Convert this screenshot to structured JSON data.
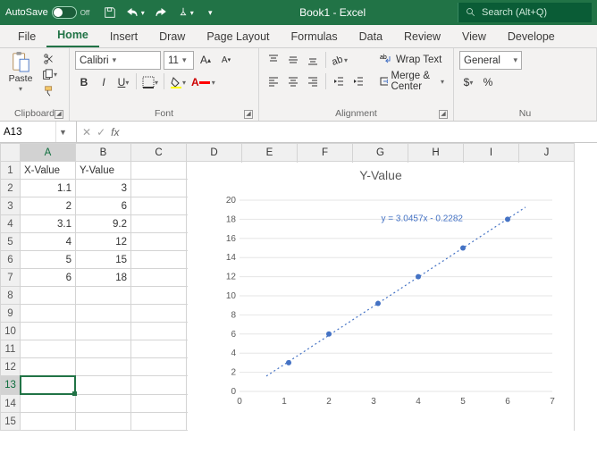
{
  "titlebar": {
    "autosave_label": "AutoSave",
    "autosave_state": "Off",
    "doc_title": "Book1 - Excel",
    "search_placeholder": "Search (Alt+Q)"
  },
  "tabs": [
    "File",
    "Home",
    "Insert",
    "Draw",
    "Page Layout",
    "Formulas",
    "Data",
    "Review",
    "View",
    "Develope"
  ],
  "active_tab": "Home",
  "ribbon": {
    "clipboard_label": "Clipboard",
    "paste_label": "Paste",
    "font_label": "Font",
    "font_name": "Calibri",
    "font_size": "11",
    "alignment_label": "Alignment",
    "wrap_text": "Wrap Text",
    "merge_center": "Merge & Center",
    "number_label": "Nu",
    "number_format": "General"
  },
  "namebox": "A13",
  "formula": "",
  "columns": [
    "A",
    "B",
    "C",
    "D",
    "E",
    "F",
    "G",
    "H",
    "I",
    "J"
  ],
  "rows": [
    "1",
    "2",
    "3",
    "4",
    "5",
    "6",
    "7",
    "8",
    "9",
    "10",
    "11",
    "12",
    "13",
    "14",
    "15"
  ],
  "selected_col": "A",
  "selected_row": "13",
  "cells": {
    "A1": "X-Value",
    "B1": "Y-Value",
    "A2": "1.1",
    "B2": "3",
    "A3": "2",
    "B3": "6",
    "A4": "3.1",
    "B4": "9.2",
    "A5": "4",
    "B5": "12",
    "A6": "5",
    "B6": "15",
    "A7": "6",
    "B7": "18"
  },
  "chart_data": {
    "type": "scatter",
    "title": "Y-Value",
    "xlabel": "",
    "ylabel": "",
    "xlim": [
      0,
      7
    ],
    "ylim": [
      0,
      20
    ],
    "xticks": [
      0,
      1,
      2,
      3,
      4,
      5,
      6,
      7
    ],
    "yticks": [
      0,
      2,
      4,
      6,
      8,
      10,
      12,
      14,
      16,
      18,
      20
    ],
    "series": [
      {
        "name": "Y-Value",
        "x": [
          1.1,
          2,
          3.1,
          4,
          5,
          6
        ],
        "y": [
          3,
          6,
          9.2,
          12,
          15,
          18
        ]
      }
    ],
    "trendline": {
      "slope": 3.0457,
      "intercept": -0.2282,
      "equation": "y = 3.0457x - 0.2282"
    }
  }
}
